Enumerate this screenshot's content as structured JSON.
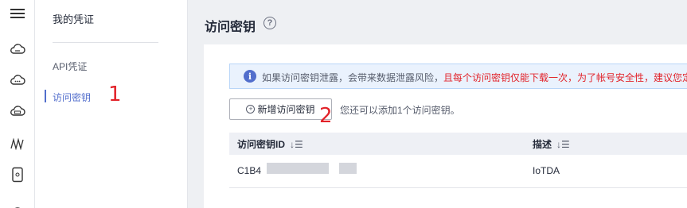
{
  "submenu": {
    "title": "我的凭证",
    "items": [
      {
        "label": "API凭证"
      },
      {
        "label": "访问密钥"
      }
    ]
  },
  "annotations": {
    "marker1": "1",
    "marker2": "2"
  },
  "page": {
    "title": "访问密钥",
    "help_glyph": "?"
  },
  "notice": {
    "info_glyph": "i",
    "text": "如果访问密钥泄露，会带来数据泄露风险，",
    "warning": "且每个访问密钥仅能下载一次，为了帐号安全性，建议您定"
  },
  "actions": {
    "add_label": "新增访问密钥",
    "hint": "您还可以添加1个访问密钥。"
  },
  "table": {
    "columns": [
      {
        "label": "访问密钥ID"
      },
      {
        "label": "描述"
      }
    ],
    "sort_glyph": "↓☰",
    "rows": [
      {
        "id": "C1B4",
        "description": "IoTDA"
      }
    ]
  },
  "icons": [
    "menu-icon",
    "cloud-icon",
    "cloud-dots-icon",
    "database-icon",
    "waveform-icon",
    "device-icon"
  ],
  "colors": {
    "accent": "#526ecc",
    "warning": "#e2232a",
    "notice_bg": "#eaf2fd"
  }
}
